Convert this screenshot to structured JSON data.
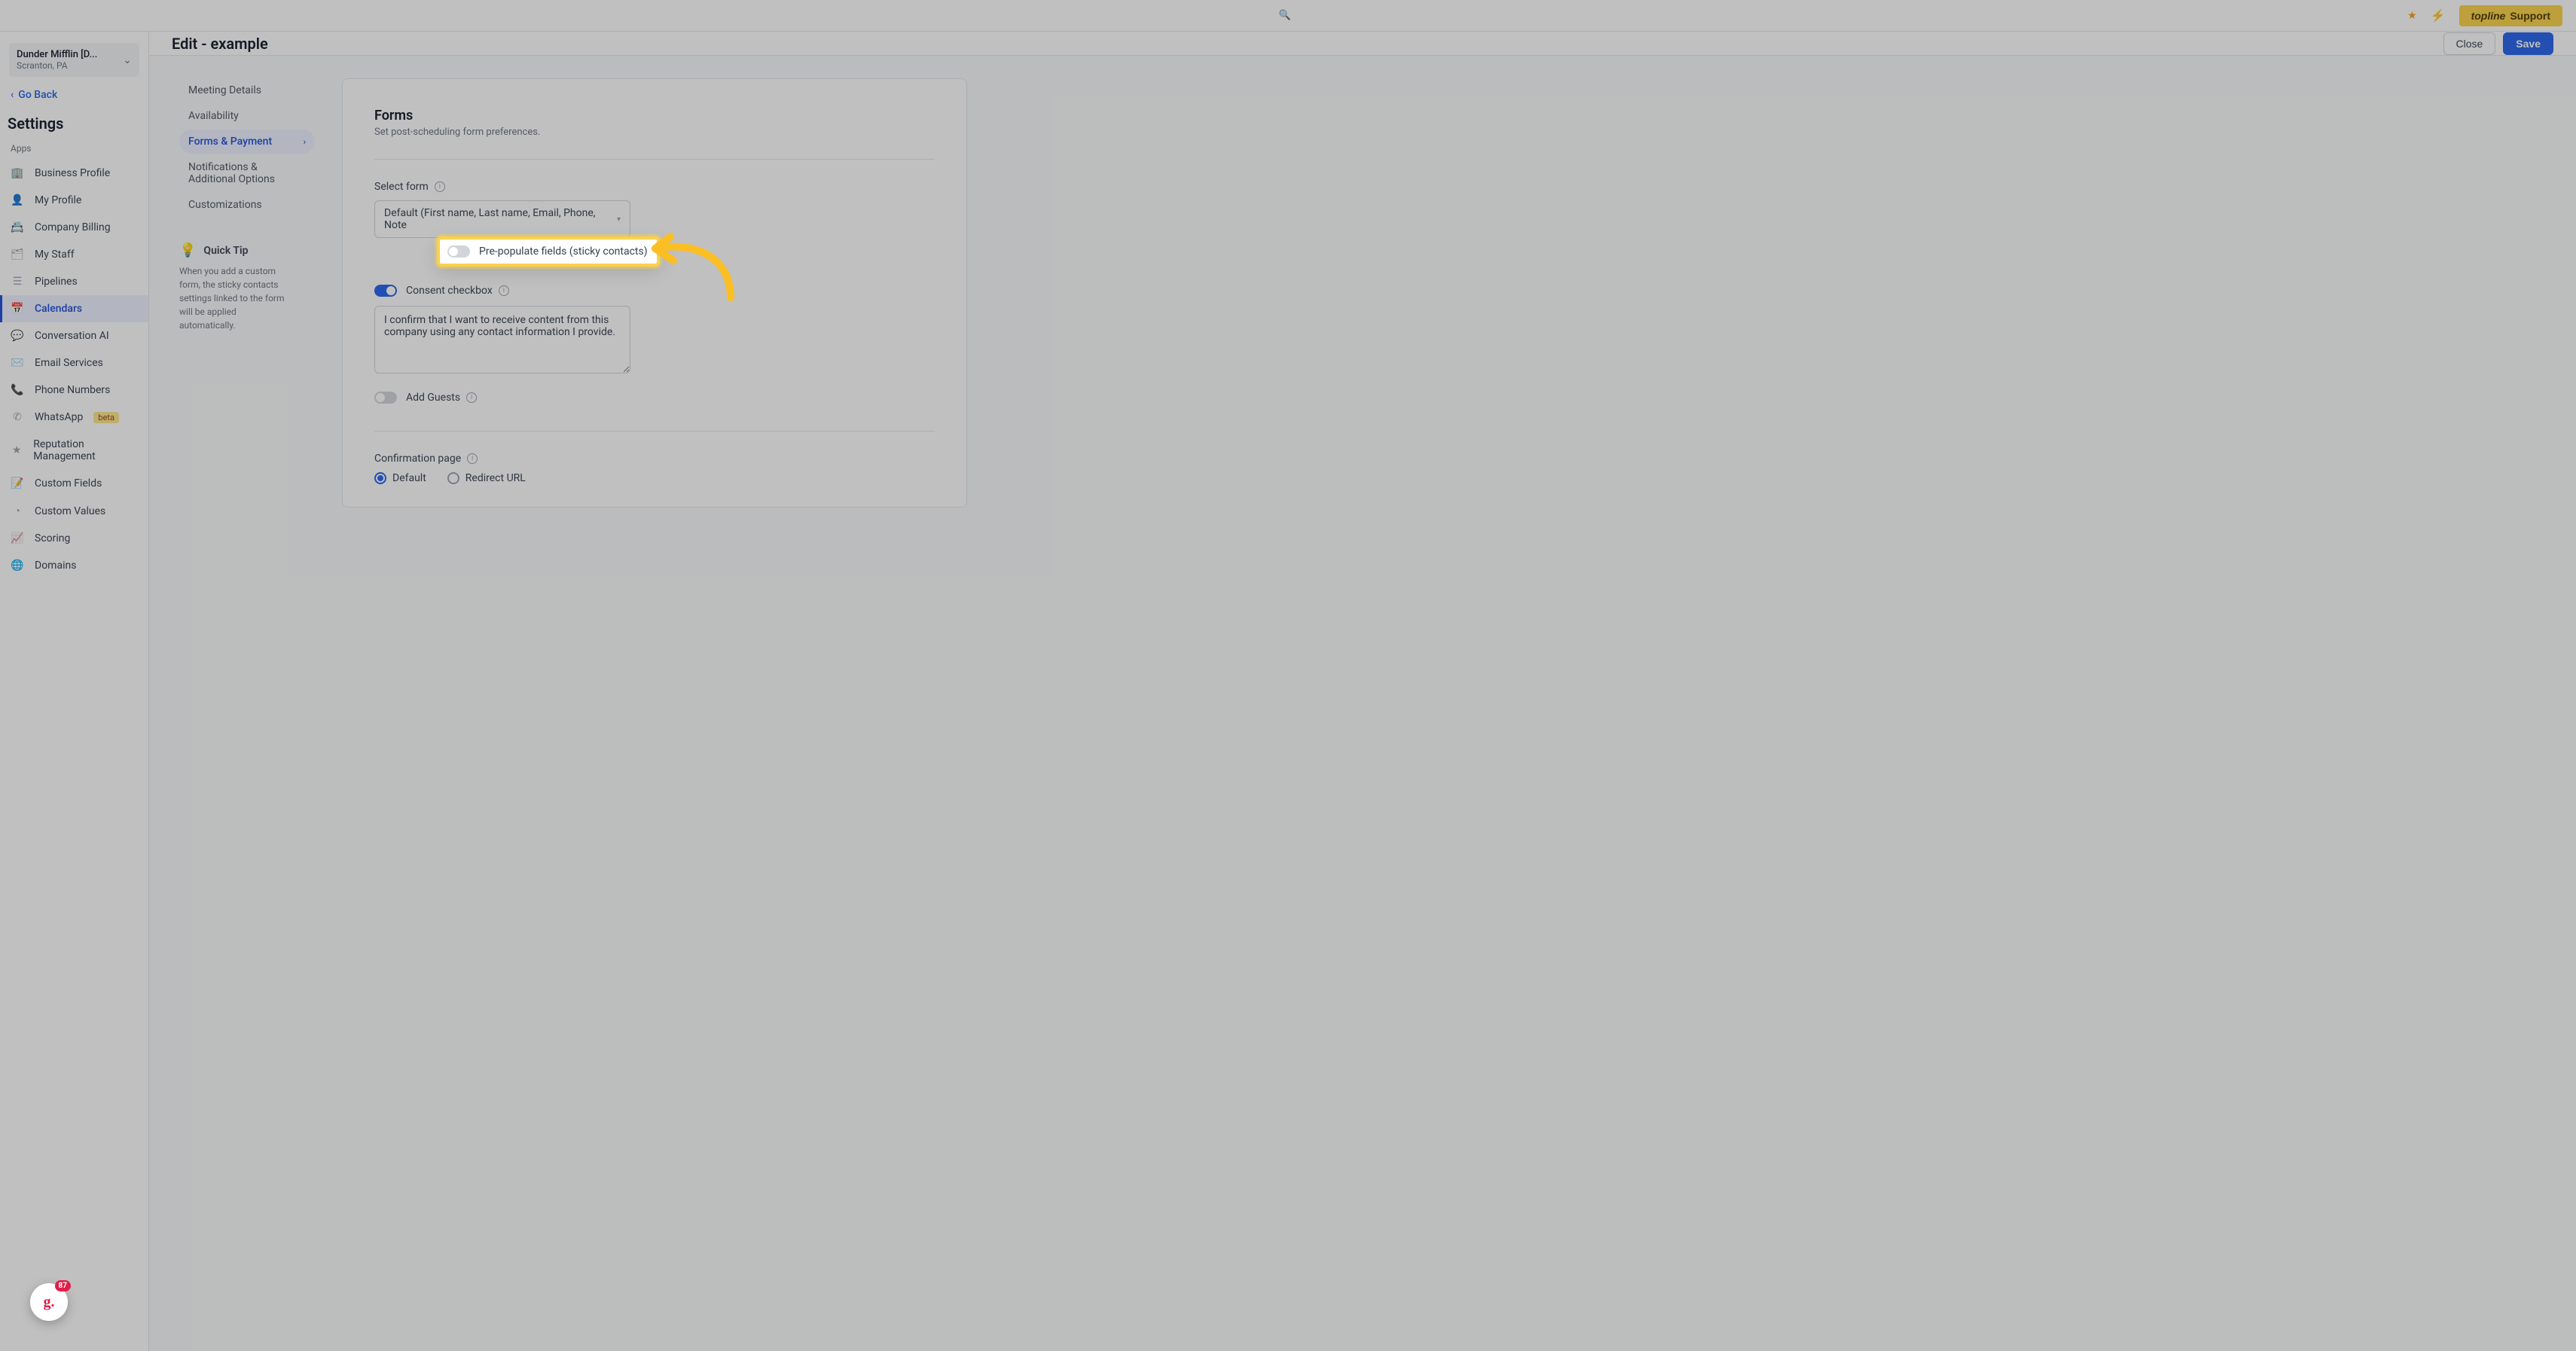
{
  "topbar": {
    "center_url": "",
    "support_btn_prefix": "topline",
    "support_btn_label": " Support"
  },
  "account_switcher": {
    "name": "Dunder Mifflin [D...",
    "location": "Scranton, PA"
  },
  "sidebar": {
    "go_back": "Go Back",
    "settings_heading": "Settings",
    "group_label": "Apps",
    "items": [
      {
        "icon": "building-icon",
        "label": "Business Profile"
      },
      {
        "icon": "user-icon",
        "label": "My Profile"
      },
      {
        "icon": "billing-icon",
        "label": "Company Billing"
      },
      {
        "icon": "staff-icon",
        "label": "My Staff"
      },
      {
        "icon": "pipeline-icon",
        "label": "Pipelines"
      },
      {
        "icon": "calendar-icon",
        "label": "Calendars",
        "active": true
      },
      {
        "icon": "chat-icon",
        "label": "Conversation AI"
      },
      {
        "icon": "mail-icon",
        "label": "Email Services"
      },
      {
        "icon": "phone-icon",
        "label": "Phone Numbers"
      },
      {
        "icon": "whatsapp-icon",
        "label": "WhatsApp",
        "badge": "beta"
      },
      {
        "icon": "star-icon",
        "label": "Reputation Management"
      },
      {
        "icon": "fields-icon",
        "label": "Custom Fields"
      },
      {
        "icon": "values-icon",
        "label": "Custom Values"
      },
      {
        "icon": "scoring-icon",
        "label": "Scoring"
      },
      {
        "icon": "domain-icon",
        "label": "Domains"
      }
    ]
  },
  "header": {
    "title": "Edit - example",
    "close": "Close",
    "save": "Save"
  },
  "tabs": {
    "items": [
      "Meeting Details",
      "Availability",
      "Forms & Payment",
      "Notifications & Additional Options",
      "Customizations"
    ],
    "active_index": 2
  },
  "quick_tip": {
    "heading": "Quick Tip",
    "body": "When you add a custom form, the sticky contacts settings linked to the form will be applied automatically."
  },
  "panel": {
    "title": "Forms",
    "subtitle": "Set post-scheduling form preferences.",
    "select_form_label": "Select form",
    "select_form_value": "Default (First name, Last name, Email, Phone, Note",
    "prepopulate_label": "Pre-populate fields (sticky contacts)",
    "consent_label": "Consent checkbox",
    "consent_text": "I confirm that I want to receive content from this company using any contact information I provide.",
    "add_guests_label": "Add Guests",
    "confirmation_label": "Confirmation page",
    "radio_default": "Default",
    "radio_redirect": "Redirect URL"
  },
  "floating_badge": {
    "count": "87"
  },
  "icon_map": {
    "building-icon": "🏢",
    "user-icon": "👤",
    "billing-icon": "📇",
    "staff-icon": "🗂",
    "pipeline-icon": "☰",
    "calendar-icon": "📅",
    "chat-icon": "💬",
    "mail-icon": "✉️",
    "phone-icon": "📞",
    "whatsapp-icon": "✆",
    "star-icon": "★",
    "fields-icon": "📝",
    "values-icon": "◔",
    "scoring-icon": "📈",
    "domain-icon": "🌐"
  }
}
